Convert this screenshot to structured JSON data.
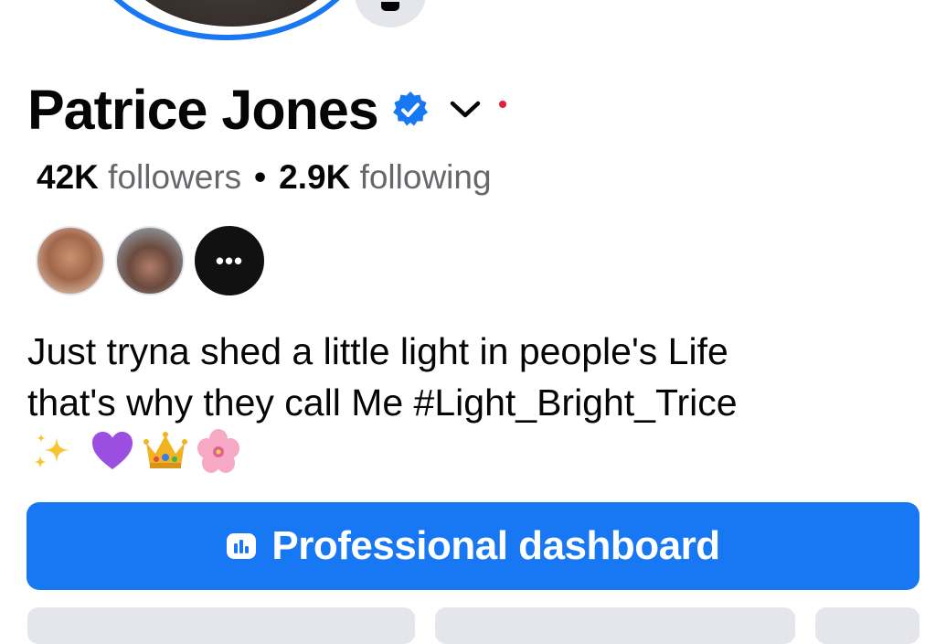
{
  "profile": {
    "name": "Patrice Jones",
    "verified": true,
    "followers_count": "42K",
    "followers_label": "followers",
    "separator": "•",
    "following_count": "2.9K",
    "following_label": "following",
    "more_friends_label": "•••",
    "bio_line1": "Just tryna shed a little light in people's Life",
    "bio_line2": "that's why they call Me #Light_Bright_Trice",
    "bio_emojis": [
      "sparkles",
      "purple-heart",
      "crown",
      "cherry-blossom"
    ]
  },
  "actions": {
    "professional_dashboard_label": "Professional dashboard"
  },
  "colors": {
    "accent": "#1877f2",
    "secondary_button": "#e4e6eb",
    "muted_text": "#65676b",
    "notification_dot": "#e41e3f"
  },
  "icons": {
    "verified": "verified-badge-icon",
    "menu": "chevron-down-icon",
    "camera": "camera-icon",
    "dashboard": "dashboard-chart-icon"
  }
}
